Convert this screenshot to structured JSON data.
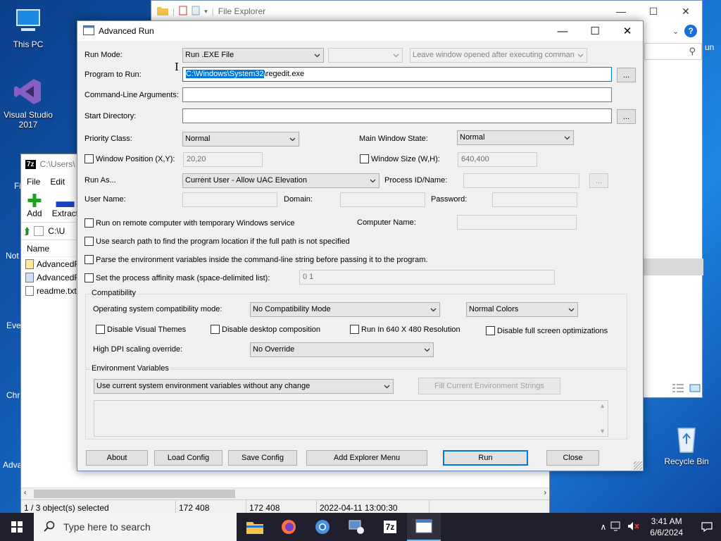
{
  "desktop": {
    "icons": [
      {
        "label": "This PC"
      },
      {
        "label": "Visual Studio\n2017"
      },
      {
        "label": "Recycle Bin"
      }
    ],
    "partial_labels": [
      "Fi",
      "Not",
      "Eve",
      "Chr",
      "Adva"
    ]
  },
  "explorer": {
    "title": "File Explorer",
    "side_label": "un"
  },
  "sevenzip": {
    "title": "C:\\Users\\",
    "menu": [
      "File",
      "Edit"
    ],
    "tools": [
      "Add",
      "Extract"
    ],
    "path": "C:\\U",
    "column": "Name",
    "files": [
      "AdvancedR",
      "AdvancedR",
      "readme.txt"
    ],
    "status": {
      "selected": "1 / 3 object(s) selected",
      "size1": "172 408",
      "size2": "172 408",
      "date": "2022-04-11 13:00:30"
    }
  },
  "dialog": {
    "title": "Advanced Run",
    "run_mode_label": "Run Mode:",
    "run_mode_value": "Run .EXE File",
    "window_option": "Leave window opened after executing comman",
    "program_label": "Program to Run:",
    "program_selected": "C:\\Windows\\System32",
    "program_rest": "\\regedit.exe",
    "args_label": "Command-Line Arguments:",
    "args_value": "",
    "startdir_label": "Start Directory:",
    "startdir_value": "",
    "browse": "...",
    "priority_label": "Priority Class:",
    "priority_value": "Normal",
    "winstate_label": "Main Window State:",
    "winstate_value": "Normal",
    "winpos_label": "Window Position (X,Y):",
    "winpos_value": "20,20",
    "winsize_label": "Window Size (W,H):",
    "winsize_value": "640,400",
    "runas_label": "Run As...",
    "runas_value": "Current User - Allow UAC Elevation",
    "pid_label": "Process ID/Name:",
    "user_label": "User Name:",
    "domain_label": "Domain:",
    "password_label": "Password:",
    "remote_label": "Run on remote computer with temporary Windows service",
    "computer_label": "Computer Name:",
    "searchpath_label": "Use search path to find the program location if the full path is not specified",
    "parseenv_label": "Parse the environment variables inside the command-line string before passing it to the program.",
    "affinity_label": "Set the process affinity mask (space-delimited list):",
    "affinity_value": "0 1",
    "compat": {
      "title": "Compatibility",
      "os_label": "Operating system compatibility mode:",
      "os_value": "No Compatibility Mode",
      "colors_value": "Normal Colors",
      "themes": "Disable Visual Themes",
      "desktop_comp": "Disable desktop composition",
      "res640": "Run In 640 X 480 Resolution",
      "fullscreen": "Disable full screen optimizations",
      "dpi_label": "High DPI scaling override:",
      "dpi_value": "No Override"
    },
    "env": {
      "title": "Environment Variables",
      "mode_value": "Use current system environment variables without any change",
      "fill_button": "Fill Current Environment Strings"
    },
    "buttons": {
      "about": "About",
      "load": "Load Config",
      "save": "Save Config",
      "explorer_menu": "Add Explorer Menu",
      "run": "Run",
      "close": "Close"
    }
  },
  "taskbar": {
    "search_placeholder": "Type here to search",
    "time": "3:41 AM",
    "date": "6/6/2024"
  }
}
